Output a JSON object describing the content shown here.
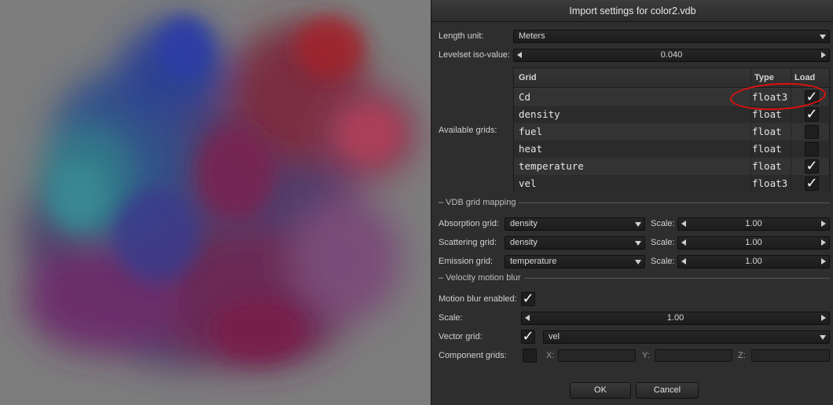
{
  "dialog": {
    "title": "Import settings for color2.vdb",
    "length_unit": {
      "label": "Length unit:",
      "value": "Meters"
    },
    "levelset": {
      "label": "Levelset iso-value:",
      "value": "0.040"
    },
    "available_grids": {
      "label": "Available grids:",
      "headers": {
        "grid": "Grid",
        "type": "Type",
        "load": "Load"
      },
      "rows": [
        {
          "name": "Cd",
          "type": "float3",
          "load": "✓"
        },
        {
          "name": "density",
          "type": "float",
          "load": "✓"
        },
        {
          "name": "fuel",
          "type": "float",
          "load": ""
        },
        {
          "name": "heat",
          "type": "float",
          "load": ""
        },
        {
          "name": "temperature",
          "type": "float",
          "load": "✓"
        },
        {
          "name": "vel",
          "type": "float3",
          "load": "✓"
        }
      ]
    },
    "vdb_mapping": {
      "section": "– VDB grid mapping",
      "absorption": {
        "label": "Absorption grid:",
        "value": "density",
        "scale_label": "Scale:",
        "scale": "1.00"
      },
      "scattering": {
        "label": "Scattering grid:",
        "value": "density",
        "scale_label": "Scale:",
        "scale": "1.00"
      },
      "emission": {
        "label": "Emission grid:",
        "value": "temperature",
        "scale_label": "Scale:",
        "scale": "1.00"
      }
    },
    "motion_blur": {
      "section": "– Velocity motion blur",
      "enabled_label": "Motion blur enabled:",
      "enabled": "✓",
      "scale_label": "Scale:",
      "scale": "1.00",
      "vector_label": "Vector grid:",
      "vector_checked": "✓",
      "vector_value": "vel",
      "component_label": "Component grids:",
      "component_checked": "",
      "x_label": "X:",
      "y_label": "Y:",
      "z_label": "Z:"
    },
    "buttons": {
      "ok": "OK",
      "cancel": "Cancel"
    },
    "colors": {
      "panel": "#2e2e2e",
      "annotation": "#e01010"
    }
  }
}
